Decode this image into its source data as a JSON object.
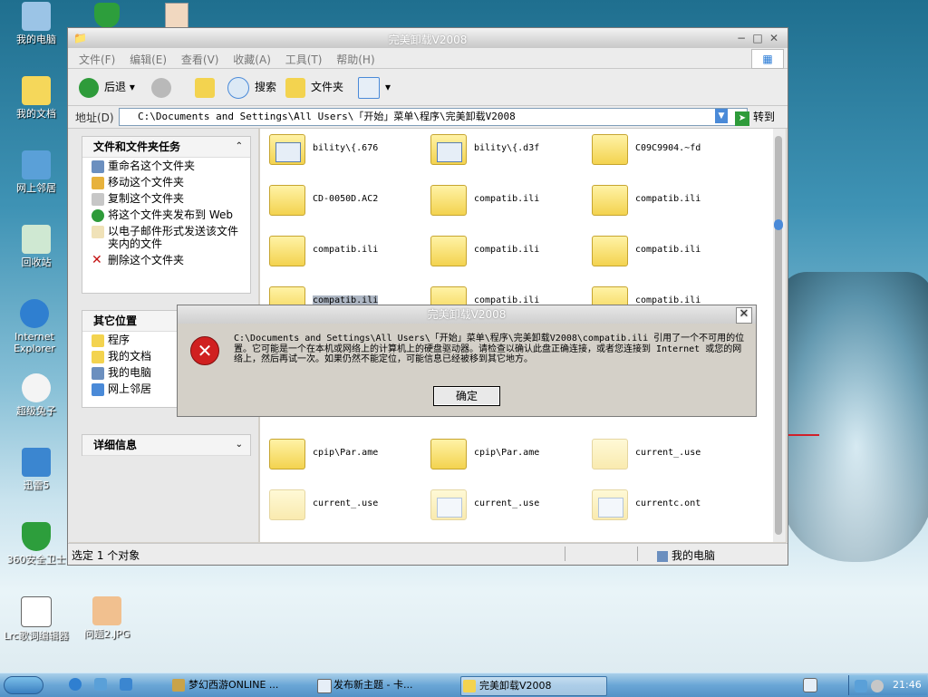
{
  "desktop": {
    "icons": [
      {
        "label": "我的电脑"
      },
      {
        "label": "我的文档"
      },
      {
        "label": "网上邻居"
      },
      {
        "label": "回收站"
      },
      {
        "label": "Internet Explorer"
      },
      {
        "label": "超级兔子"
      },
      {
        "label": "迅雷5"
      },
      {
        "label": "360安全卫士"
      },
      {
        "label": "Lrc歌词编辑器"
      },
      {
        "label": "问题2.JPG"
      }
    ]
  },
  "window": {
    "title": "完美卸载V2008",
    "menu": [
      "文件(F)",
      "编辑(E)",
      "查看(V)",
      "收藏(A)",
      "工具(T)",
      "帮助(H)"
    ],
    "toolbar": {
      "back": "后退",
      "search": "搜索",
      "folders": "文件夹"
    },
    "address": {
      "label": "地址(D)",
      "value": "C:\\Documents and Settings\\All Users\\「开始」菜单\\程序\\完美卸载V2008",
      "go": "转到"
    },
    "tasks": {
      "title": "文件和文件夹任务",
      "items": [
        "重命名这个文件夹",
        "移动这个文件夹",
        "复制这个文件夹",
        "将这个文件夹发布到 Web",
        "以电子邮件形式发送该文件夹内的文件",
        "删除这个文件夹"
      ]
    },
    "places": {
      "title": "其它位置",
      "items": [
        "程序",
        "我的文档",
        "我的电脑",
        "网上邻居"
      ]
    },
    "details": {
      "title": "详细信息"
    },
    "files": [
      "bility\\{.676",
      "bility\\{.d3f",
      "C09C9904.~fd",
      "CD-0050D.AC2",
      "compatib.ili",
      "compatib.ili",
      "compatib.ili",
      "compatib.ili",
      "compatib.ili",
      "compatib.ili",
      "compatib.ili",
      "compatib.ili",
      "cpip\\Par.ame",
      "cpip\\Par.ame",
      "current_.use",
      "current_.use",
      "current_.use",
      "currentc.ont"
    ],
    "status": {
      "left": "选定 1 个对象",
      "right": "我的电脑"
    }
  },
  "dialog": {
    "title": "完美卸载V2008",
    "message": "C:\\Documents and Settings\\All Users\\「开始」菜单\\程序\\完美卸载V2008\\compatib.ili 引用了一个不可用的位置。它可能是一个在本机或网络上的计算机上的硬盘驱动器。请检查以确认此盘正确连接，或者您连接到 Internet 或您的网络上，然后再试一次。如果仍然不能定位，可能信息已经被移到其它地方。",
    "ok": "确定"
  },
  "taskbar": {
    "tasks": [
      "梦幻西游ONLINE ...",
      "发布新主题 - 卡...",
      "完美卸载V2008"
    ],
    "clock": "21:46"
  }
}
